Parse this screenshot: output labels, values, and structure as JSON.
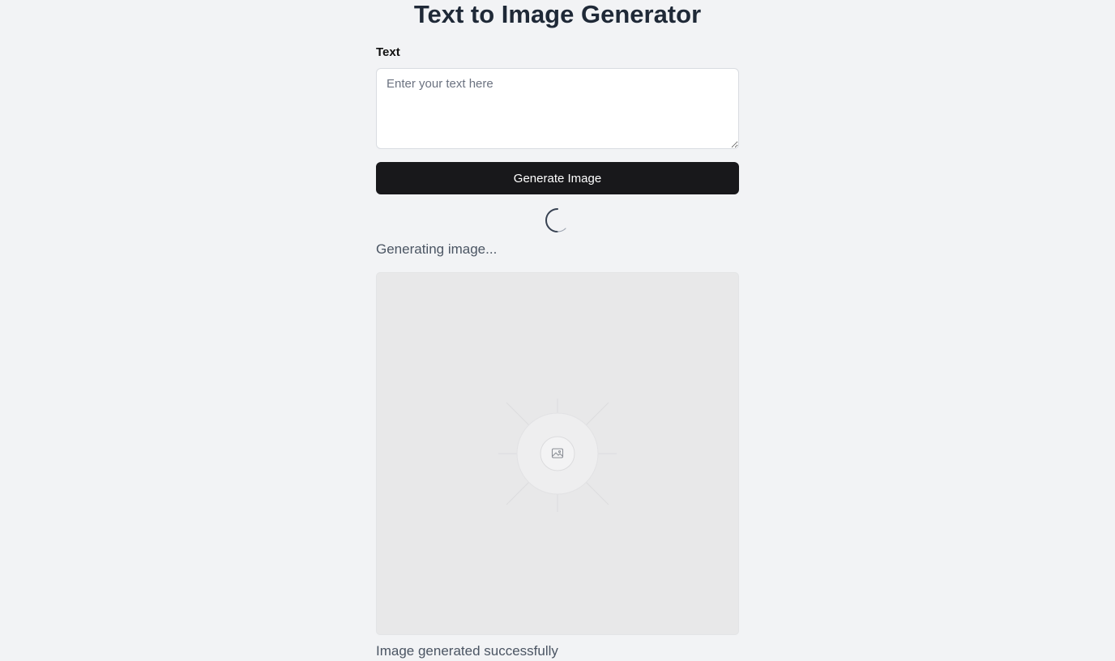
{
  "header": {
    "title": "Text to Image Generator"
  },
  "form": {
    "text_label": "Text",
    "text_placeholder": "Enter your text here",
    "text_value": "",
    "generate_button_label": "Generate Image"
  },
  "status": {
    "loading_text": "Generating image...",
    "result_text": "Image generated successfully"
  },
  "icons": {
    "spinner": "loading-spinner-icon",
    "image_placeholder": "image-icon"
  },
  "colors": {
    "background": "#f2f3f5",
    "button": "#18181b",
    "title": "#1f2937",
    "muted_text": "#4b5563"
  }
}
